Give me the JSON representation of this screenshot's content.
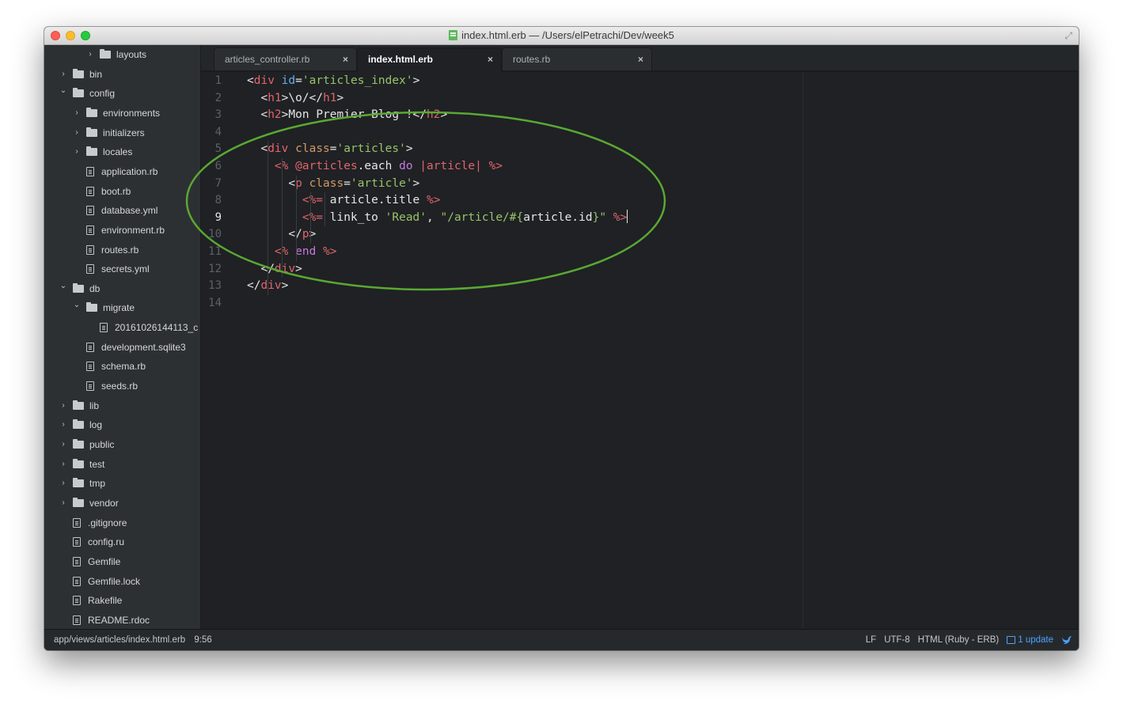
{
  "window": {
    "title": "index.html.erb — /Users/elPetrachi/Dev/week5"
  },
  "sidebar": {
    "items": [
      {
        "label": "layouts",
        "type": "folder",
        "expanded": false
      },
      {
        "label": "bin",
        "type": "folder",
        "expanded": false
      },
      {
        "label": "config",
        "type": "folder",
        "expanded": true
      },
      {
        "label": "environments",
        "type": "folder",
        "expanded": false
      },
      {
        "label": "initializers",
        "type": "folder",
        "expanded": false
      },
      {
        "label": "locales",
        "type": "folder",
        "expanded": false
      },
      {
        "label": "application.rb",
        "type": "file"
      },
      {
        "label": "boot.rb",
        "type": "file"
      },
      {
        "label": "database.yml",
        "type": "file"
      },
      {
        "label": "environment.rb",
        "type": "file"
      },
      {
        "label": "routes.rb",
        "type": "file"
      },
      {
        "label": "secrets.yml",
        "type": "file"
      },
      {
        "label": "db",
        "type": "folder",
        "expanded": true
      },
      {
        "label": "migrate",
        "type": "folder",
        "expanded": true
      },
      {
        "label": "20161026144113_c",
        "type": "file"
      },
      {
        "label": "development.sqlite3",
        "type": "file"
      },
      {
        "label": "schema.rb",
        "type": "file"
      },
      {
        "label": "seeds.rb",
        "type": "file"
      },
      {
        "label": "lib",
        "type": "folder",
        "expanded": false
      },
      {
        "label": "log",
        "type": "folder",
        "expanded": false
      },
      {
        "label": "public",
        "type": "folder",
        "expanded": false
      },
      {
        "label": "test",
        "type": "folder",
        "expanded": false
      },
      {
        "label": "tmp",
        "type": "folder",
        "expanded": false
      },
      {
        "label": "vendor",
        "type": "folder",
        "expanded": false
      },
      {
        "label": ".gitignore",
        "type": "file"
      },
      {
        "label": "config.ru",
        "type": "file"
      },
      {
        "label": "Gemfile",
        "type": "file"
      },
      {
        "label": "Gemfile.lock",
        "type": "file"
      },
      {
        "label": "Rakefile",
        "type": "file"
      },
      {
        "label": "README.rdoc",
        "type": "file"
      }
    ]
  },
  "tabs": [
    {
      "label": "articles_controller.rb",
      "active": false,
      "close": "×"
    },
    {
      "label": "index.html.erb",
      "active": true,
      "close": "×"
    },
    {
      "label": "routes.rb",
      "active": false,
      "close": "×"
    }
  ],
  "editor": {
    "current_line": 9,
    "lines": [
      {
        "n": "1",
        "parts": [
          [
            "t-p",
            "<"
          ],
          [
            "t-tag",
            "div"
          ],
          [
            "t-p",
            " "
          ],
          [
            "t-id",
            "id"
          ],
          [
            "t-p",
            "="
          ],
          [
            "t-str",
            "'articles_index'"
          ],
          [
            "t-p",
            ">"
          ]
        ]
      },
      {
        "n": "2",
        "parts": [
          [
            "t-p",
            "  <"
          ],
          [
            "t-tag",
            "h1"
          ],
          [
            "t-p",
            ">\\o/</"
          ],
          [
            "t-tag",
            "h1"
          ],
          [
            "t-p",
            ">"
          ]
        ]
      },
      {
        "n": "3",
        "parts": [
          [
            "t-p",
            "  <"
          ],
          [
            "t-tag",
            "h2"
          ],
          [
            "t-p",
            ">Mon Premier Blog !</"
          ],
          [
            "t-tag",
            "h2"
          ],
          [
            "t-p",
            ">"
          ]
        ]
      },
      {
        "n": "4",
        "parts": []
      },
      {
        "n": "5",
        "parts": [
          [
            "t-p",
            "  <"
          ],
          [
            "t-tag",
            "div"
          ],
          [
            "t-p",
            " "
          ],
          [
            "t-attr",
            "class"
          ],
          [
            "t-p",
            "="
          ],
          [
            "t-str",
            "'articles'"
          ],
          [
            "t-p",
            ">"
          ]
        ]
      },
      {
        "n": "6",
        "parts": [
          [
            "t-p",
            "    "
          ],
          [
            "t-erb",
            "<%"
          ],
          [
            "t-p",
            " "
          ],
          [
            "t-ivar",
            "@articles"
          ],
          [
            "t-txt",
            ".each "
          ],
          [
            "t-kw",
            "do"
          ],
          [
            "t-p",
            " "
          ],
          [
            "t-var",
            "|article|"
          ],
          [
            "t-p",
            " "
          ],
          [
            "t-erb",
            "%>"
          ]
        ]
      },
      {
        "n": "7",
        "parts": [
          [
            "t-p",
            "      <"
          ],
          [
            "t-tag",
            "p"
          ],
          [
            "t-p",
            " "
          ],
          [
            "t-attr",
            "class"
          ],
          [
            "t-p",
            "="
          ],
          [
            "t-str",
            "'article'"
          ],
          [
            "t-p",
            ">"
          ]
        ]
      },
      {
        "n": "8",
        "parts": [
          [
            "t-p",
            "        "
          ],
          [
            "t-erb",
            "<%="
          ],
          [
            "t-txt",
            " article.title "
          ],
          [
            "t-erb",
            "%>"
          ]
        ]
      },
      {
        "n": "9",
        "parts": [
          [
            "t-p",
            "        "
          ],
          [
            "t-erb",
            "<%="
          ],
          [
            "t-txt",
            " link_to "
          ],
          [
            "t-str",
            "'Read'"
          ],
          [
            "t-txt",
            ", "
          ],
          [
            "t-str",
            "\"/article/"
          ],
          [
            "t-interp",
            "#{"
          ],
          [
            "t-txt",
            "article.id"
          ],
          [
            "t-interp",
            "}"
          ],
          [
            "t-str",
            "\""
          ],
          [
            "t-txt",
            " "
          ],
          [
            "t-erb",
            "%>"
          ]
        ]
      },
      {
        "n": "10",
        "parts": [
          [
            "t-p",
            "      </"
          ],
          [
            "t-tag",
            "p"
          ],
          [
            "t-p",
            ">"
          ]
        ]
      },
      {
        "n": "11",
        "parts": [
          [
            "t-p",
            "    "
          ],
          [
            "t-erb",
            "<%"
          ],
          [
            "t-p",
            " "
          ],
          [
            "t-kw",
            "end"
          ],
          [
            "t-p",
            " "
          ],
          [
            "t-erb",
            "%>"
          ]
        ]
      },
      {
        "n": "12",
        "parts": [
          [
            "t-p",
            "  </"
          ],
          [
            "t-tag",
            "div"
          ],
          [
            "t-p",
            ">"
          ]
        ]
      },
      {
        "n": "13",
        "parts": [
          [
            "t-p",
            "</"
          ],
          [
            "t-tag",
            "div"
          ],
          [
            "t-p",
            ">"
          ]
        ]
      },
      {
        "n": "14",
        "parts": []
      }
    ]
  },
  "status": {
    "path": "app/views/articles/index.html.erb",
    "cursor": "9:56",
    "line_ending": "LF",
    "encoding": "UTF-8",
    "grammar": "HTML (Ruby - ERB)",
    "update": "1 update"
  },
  "colors": {
    "annotation": "#5aa832",
    "accent": "#4aa3ff"
  }
}
